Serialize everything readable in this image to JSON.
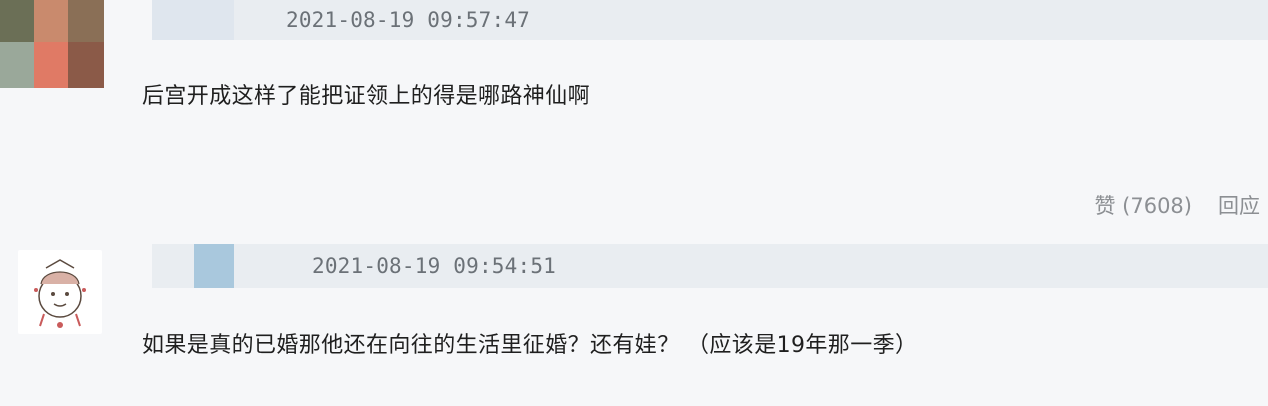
{
  "comments": [
    {
      "timestamp": "2021-08-19 09:57:47",
      "text": "后宫开成这样了能把证领上的得是哪路神仙啊",
      "actions": {
        "like_label": "赞 (7608)",
        "reply_label": "回应"
      },
      "avatar_icon": "pixelated-avatar"
    },
    {
      "timestamp": "2021-08-19 09:54:51",
      "text": "如果是真的已婚那他还在向往的生活里征婚？还有娃？ （应该是19年那一季）",
      "avatar_icon": "cartoon-avatar"
    }
  ],
  "colors": {
    "background": "#f6f7f9",
    "meta_bar": "#e9edf1",
    "timestamp": "#6b7177",
    "action_text": "#8c8f93",
    "name_mask_blue": "#a9c8dd"
  }
}
